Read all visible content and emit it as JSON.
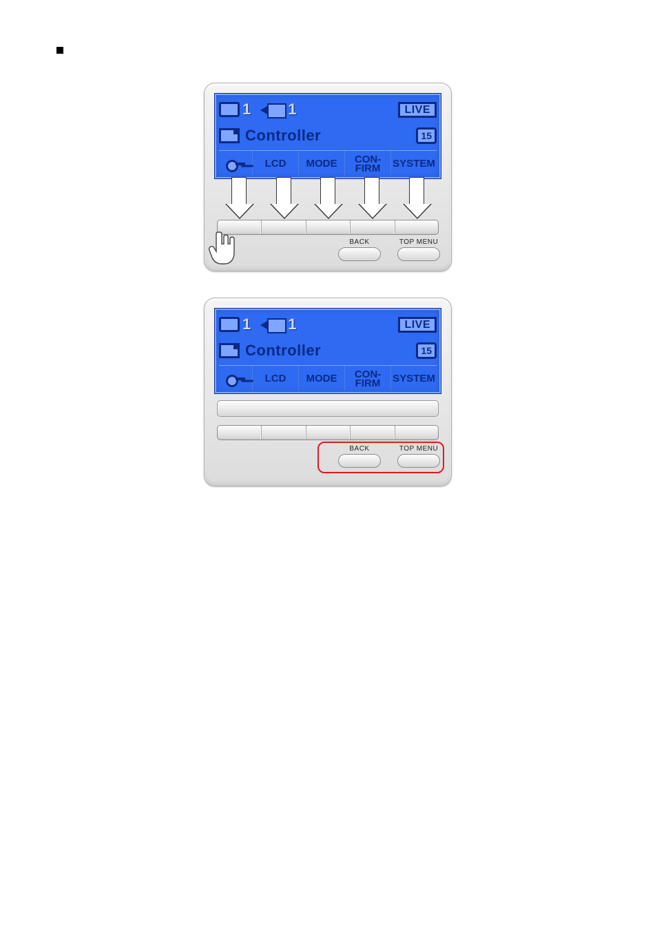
{
  "screen": {
    "top": {
      "monitor_number": "1",
      "camera_number": "1",
      "live_badge": "LIVE"
    },
    "mid": {
      "title": "Controller",
      "badge": "15"
    },
    "menu": {
      "items": [
        {
          "kind": "key-icon"
        },
        {
          "label": "LCD"
        },
        {
          "label": "MODE"
        },
        {
          "label": "CON-\nFIRM"
        },
        {
          "label": "SYSTEM"
        }
      ]
    }
  },
  "buttons": {
    "back": "BACK",
    "top_menu": "TOP MENU"
  }
}
